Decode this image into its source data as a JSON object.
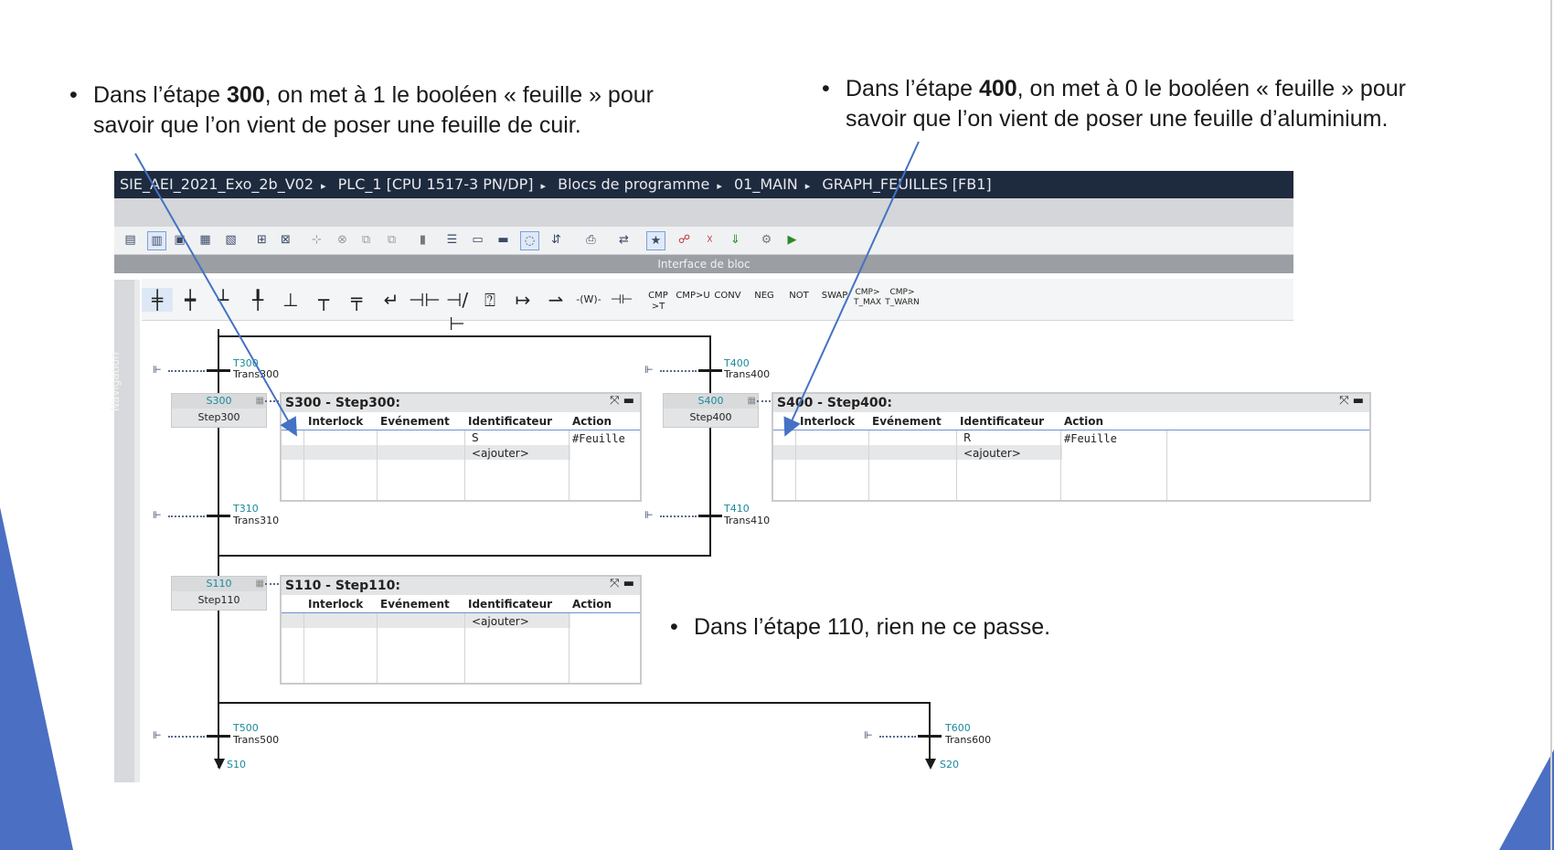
{
  "bullets": {
    "b300": {
      "pre": "Dans l’étape ",
      "num": "300",
      "post": ", on met à 1 le booléen « feuille » pour",
      "line2": "savoir que l’on vient de poser une feuille de cuir."
    },
    "b400": {
      "pre": "Dans l’étape ",
      "num": "400",
      "post": ", on met à 0 le booléen « feuille » pour",
      "line2": "savoir que l’on vient de poser une feuille d’aluminium."
    },
    "b110": {
      "text": "Dans l’étape 110, rien ne ce passe."
    },
    "dot": "•"
  },
  "breadcrumb": [
    "SIE_AEI_2021_Exo_2b_V02",
    "PLC_1 [CPU 1517-3 PN/DP]",
    "Blocs de programme",
    "01_MAIN",
    "GRAPH_FEUILLES [FB1]"
  ],
  "interface_bar": "Interface de bloc",
  "navigation_label": "Navigation",
  "toolbar2_text": [
    "CMP >T",
    "CMP>U",
    "CONV",
    "NEG",
    "NOT",
    "SWAP"
  ],
  "toolbar2_text2": [
    {
      "a": "CMP>",
      "b": "T_MAX"
    },
    {
      "a": "CMP>",
      "b": "T_WARN"
    }
  ],
  "transitions": {
    "t300": {
      "id": "T300",
      "name": "Trans300"
    },
    "t400": {
      "id": "T400",
      "name": "Trans400"
    },
    "t310": {
      "id": "T310",
      "name": "Trans310"
    },
    "t410": {
      "id": "T410",
      "name": "Trans410"
    },
    "t500": {
      "id": "T500",
      "name": "Trans500"
    },
    "t600": {
      "id": "T600",
      "name": "Trans600"
    }
  },
  "jumps": {
    "s10": "S10",
    "s20": "S20"
  },
  "steps": {
    "s300": {
      "id": "S300",
      "name": "Step300"
    },
    "s400": {
      "id": "S400",
      "name": "Step400"
    },
    "s110": {
      "id": "S110",
      "name": "Step110"
    }
  },
  "columns": {
    "interlock": "Interlock",
    "event": "Evénement",
    "identifier": "Identificateur",
    "action": "Action"
  },
  "panels": {
    "p300": {
      "title": "S300 - Step300:",
      "ident": "S",
      "action": "#Feuille",
      "add": "<ajouter>"
    },
    "p400": {
      "title": "S400 - Step400:",
      "ident": "R",
      "action": "#Feuille",
      "add": "<ajouter>"
    },
    "p110": {
      "title": "S110 - Step110:",
      "add": "<ajouter>"
    }
  },
  "panel_controls": "⤧ ▬",
  "colors": {
    "accent_blue": "#4472c4",
    "title_dark": "#1e2a3e",
    "teal": "#1a8a9a"
  }
}
